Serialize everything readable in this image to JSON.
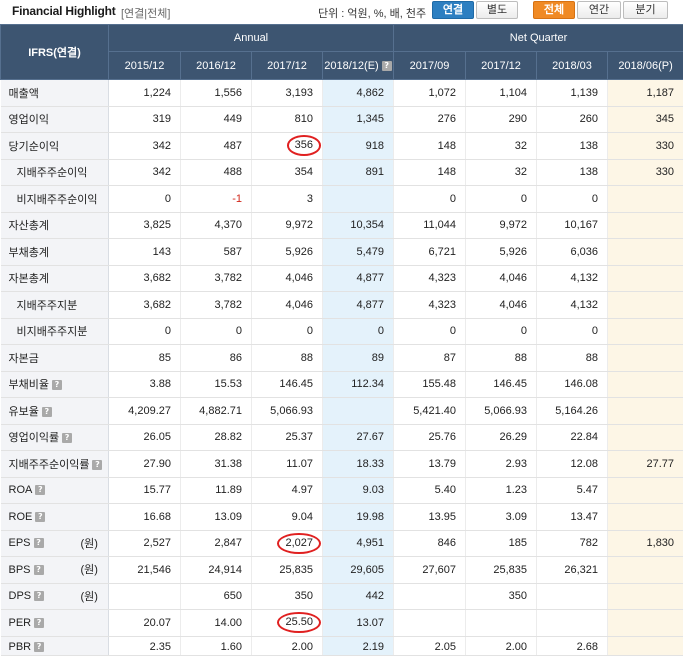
{
  "header": {
    "title": "Financial Highlight",
    "subtitle": "[연결|전체]",
    "unit_text": "단위 : 억원, %, 배, 천주",
    "scope_tabs": [
      {
        "label": "연결",
        "active": true
      },
      {
        "label": "별도",
        "active": false
      }
    ],
    "period_tabs": [
      {
        "label": "전체",
        "active": true
      },
      {
        "label": "연간",
        "active": false
      },
      {
        "label": "분기",
        "active": false
      }
    ]
  },
  "table": {
    "corner_label": "IFRS(연결)",
    "group_annual": "Annual",
    "group_quarter": "Net Quarter",
    "columns": [
      "2015/12",
      "2016/12",
      "2017/12",
      "2018/12(E)",
      "2017/09",
      "2017/12",
      "2018/03",
      "2018/06(P)"
    ],
    "rows": [
      {
        "label": "매출액",
        "indent": false,
        "help": false,
        "unit": "",
        "values": [
          "1,224",
          "1,556",
          "3,193",
          "4,862",
          "1,072",
          "1,104",
          "1,139",
          "1,187"
        ]
      },
      {
        "label": "영업이익",
        "indent": false,
        "help": false,
        "unit": "",
        "values": [
          "319",
          "449",
          "810",
          "1,345",
          "276",
          "290",
          "260",
          "345"
        ]
      },
      {
        "label": "당기순이익",
        "indent": false,
        "help": false,
        "unit": "",
        "values": [
          "342",
          "487",
          "356",
          "918",
          "148",
          "32",
          "138",
          "330"
        ],
        "circled": [
          2
        ]
      },
      {
        "label": "지배주주순이익",
        "indent": true,
        "help": false,
        "unit": "",
        "values": [
          "342",
          "488",
          "354",
          "891",
          "148",
          "32",
          "138",
          "330"
        ]
      },
      {
        "label": "비지배주주순이익",
        "indent": true,
        "help": false,
        "unit": "",
        "values": [
          "0",
          "-1",
          "3",
          "",
          "0",
          "0",
          "0",
          ""
        ]
      },
      {
        "label": "자산총계",
        "indent": false,
        "help": false,
        "unit": "",
        "values": [
          "3,825",
          "4,370",
          "9,972",
          "10,354",
          "11,044",
          "9,972",
          "10,167",
          ""
        ]
      },
      {
        "label": "부채총계",
        "indent": false,
        "help": false,
        "unit": "",
        "values": [
          "143",
          "587",
          "5,926",
          "5,479",
          "6,721",
          "5,926",
          "6,036",
          ""
        ]
      },
      {
        "label": "자본총계",
        "indent": false,
        "help": false,
        "unit": "",
        "values": [
          "3,682",
          "3,782",
          "4,046",
          "4,877",
          "4,323",
          "4,046",
          "4,132",
          ""
        ]
      },
      {
        "label": "지배주주지분",
        "indent": true,
        "help": false,
        "unit": "",
        "values": [
          "3,682",
          "3,782",
          "4,046",
          "4,877",
          "4,323",
          "4,046",
          "4,132",
          ""
        ]
      },
      {
        "label": "비지배주주지분",
        "indent": true,
        "help": false,
        "unit": "",
        "values": [
          "0",
          "0",
          "0",
          "0",
          "0",
          "0",
          "0",
          ""
        ]
      },
      {
        "label": "자본금",
        "indent": false,
        "help": false,
        "unit": "",
        "values": [
          "85",
          "86",
          "88",
          "89",
          "87",
          "88",
          "88",
          ""
        ]
      },
      {
        "label": "부채비율",
        "indent": false,
        "help": true,
        "unit": "",
        "values": [
          "3.88",
          "15.53",
          "146.45",
          "112.34",
          "155.48",
          "146.45",
          "146.08",
          ""
        ]
      },
      {
        "label": "유보율",
        "indent": false,
        "help": true,
        "unit": "",
        "values": [
          "4,209.27",
          "4,882.71",
          "5,066.93",
          "",
          "5,421.40",
          "5,066.93",
          "5,164.26",
          ""
        ]
      },
      {
        "label": "영업이익률",
        "indent": false,
        "help": true,
        "unit": "",
        "values": [
          "26.05",
          "28.82",
          "25.37",
          "27.67",
          "25.76",
          "26.29",
          "22.84",
          ""
        ]
      },
      {
        "label": "지배주주순이익률",
        "indent": false,
        "help": true,
        "unit": "",
        "values": [
          "27.90",
          "31.38",
          "11.07",
          "18.33",
          "13.79",
          "2.93",
          "12.08",
          "27.77"
        ]
      },
      {
        "label": "ROA",
        "indent": false,
        "help": true,
        "unit": "",
        "values": [
          "15.77",
          "11.89",
          "4.97",
          "9.03",
          "5.40",
          "1.23",
          "5.47",
          ""
        ]
      },
      {
        "label": "ROE",
        "indent": false,
        "help": true,
        "unit": "",
        "values": [
          "16.68",
          "13.09",
          "9.04",
          "19.98",
          "13.95",
          "3.09",
          "13.47",
          ""
        ]
      },
      {
        "label": "EPS",
        "indent": false,
        "help": true,
        "unit": "(원)",
        "values": [
          "2,527",
          "2,847",
          "2,027",
          "4,951",
          "846",
          "185",
          "782",
          "1,830"
        ],
        "circled": [
          2
        ]
      },
      {
        "label": "BPS",
        "indent": false,
        "help": true,
        "unit": "(원)",
        "values": [
          "21,546",
          "24,914",
          "25,835",
          "29,605",
          "27,607",
          "25,835",
          "26,321",
          ""
        ]
      },
      {
        "label": "DPS",
        "indent": false,
        "help": true,
        "unit": "(원)",
        "values": [
          "",
          "650",
          "350",
          "442",
          "",
          "350",
          "",
          ""
        ]
      },
      {
        "label": "PER",
        "indent": false,
        "help": true,
        "unit": "",
        "values": [
          "20.07",
          "14.00",
          "25.50",
          "13.07",
          "",
          "",
          "",
          ""
        ],
        "circled": [
          2
        ]
      },
      {
        "label": "PBR",
        "indent": false,
        "help": true,
        "unit": "",
        "values": [
          "2.35",
          "1.60",
          "2.00",
          "2.19",
          "2.05",
          "2.00",
          "2.68",
          ""
        ],
        "cut": true
      }
    ]
  },
  "colors": {
    "header_bg": "#3d5571",
    "estimate_col_bg": "#e4f2fb",
    "provisional_col_bg": "#fdf6e6",
    "active_scope_tab": "#2d7fc1",
    "active_period_tab": "#f08a24",
    "negative_value": "#d0261a",
    "annotation_circle": "#e02020"
  }
}
